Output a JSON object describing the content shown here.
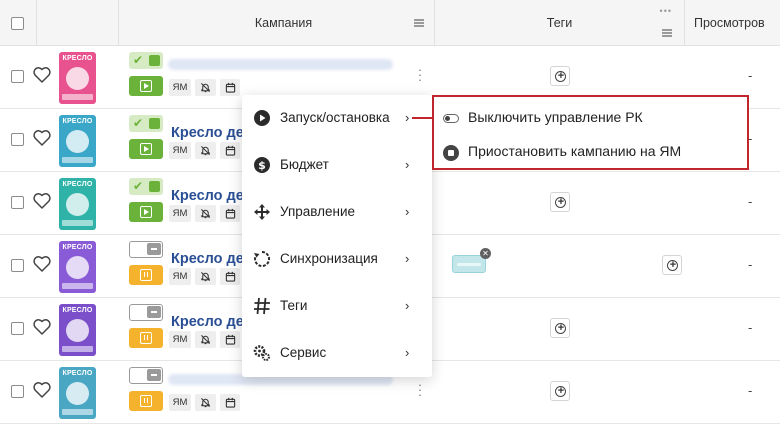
{
  "header": {
    "campaign_col": "Кампания",
    "tags_col": "Теги",
    "views_col": "Просмотров"
  },
  "colors": {
    "accent_green": "#6ab23a",
    "pause_orange": "#f5b22c",
    "title_blue": "#2a4f95",
    "highlight_red": "#c0262b"
  },
  "rows": [
    {
      "title": "",
      "status": "on",
      "thumb_label": "КРЕСЛО",
      "thumb_color": "#e8538f",
      "views": "-"
    },
    {
      "title": "Кресло дет",
      "status": "on",
      "thumb_label": "КРЕСЛО",
      "thumb_color": "#3aa7c8",
      "views": "-"
    },
    {
      "title": "Кресло дет",
      "status": "on",
      "thumb_label": "КРЕСЛО",
      "thumb_color": "#2fb3a8",
      "views": "-"
    },
    {
      "title": "Кресло дет",
      "status": "off",
      "thumb_label": "КРЕСЛО",
      "thumb_color": "#8a5bd6",
      "views": "-"
    },
    {
      "title": "Кресло дет",
      "status": "off",
      "thumb_label": "КРЕСЛО",
      "thumb_color": "#7a4fc9",
      "views": "-"
    },
    {
      "title": "",
      "status": "off",
      "thumb_label": "КРЕСЛО",
      "thumb_color": "#4aa7c4",
      "views": "-"
    }
  ],
  "mini_buttons": {
    "ym_label": "ЯМ",
    "bell_icon": "bell-off-icon",
    "calendar_icon": "calendar-icon"
  },
  "context_menu": {
    "items": [
      {
        "label": "Запуск/остановка",
        "icon": "play-circle-icon"
      },
      {
        "label": "Бюджет",
        "icon": "dollar-icon"
      },
      {
        "label": "Управление",
        "icon": "move-icon"
      },
      {
        "label": "Синхронизация",
        "icon": "sync-icon"
      },
      {
        "label": "Теги",
        "icon": "hash-icon"
      },
      {
        "label": "Сервис",
        "icon": "gears-icon"
      }
    ],
    "arrow": "›"
  },
  "submenu": {
    "items": [
      {
        "label": "Выключить управление РК",
        "icon": "toggle-icon"
      },
      {
        "label": "Приостановить кампанию на ЯМ",
        "icon": "stop-circle-icon"
      }
    ]
  }
}
